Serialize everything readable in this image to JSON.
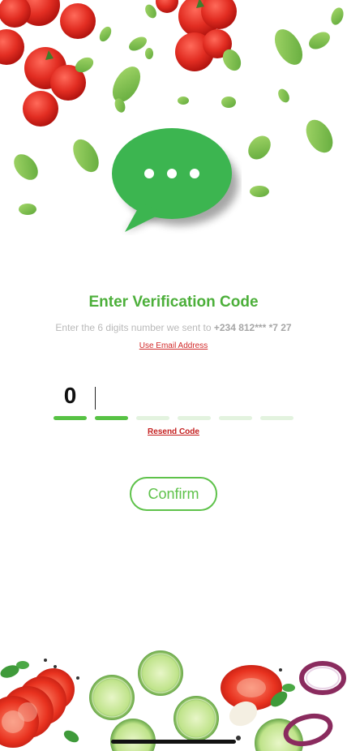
{
  "colors": {
    "brand_green": "#4caf3a",
    "link_red": "#d12a2a",
    "bubble_green": "#3cb550"
  },
  "illustration": {
    "top": "tomato-and-leaves-decor",
    "bubble": "chat-bubble-icon",
    "bottom": "vegetables-decor"
  },
  "verification": {
    "title": "Enter Verification Code",
    "subtitle_prefix": "Enter the 6 digits number we sent to",
    "phone": "+234 812*** *7 27",
    "email_link": "Use Email Address"
  },
  "otp": {
    "length": 6,
    "digits": [
      "0",
      "",
      "",
      "",
      "",
      ""
    ],
    "filled_count": 2
  },
  "resend_label": "Resend Code",
  "confirm_label": "Confirm"
}
